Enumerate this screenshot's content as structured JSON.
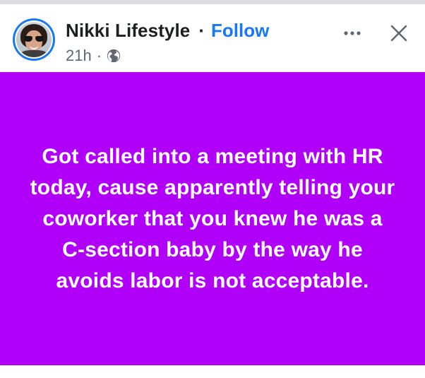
{
  "post": {
    "author_name": "Nikki Lifestyle",
    "separator": "·",
    "follow_label": "Follow",
    "timestamp": "21h",
    "meta_separator": "·",
    "audience_icon": "globe-icon",
    "more_icon": "more-horizontal-icon",
    "close_icon": "close-icon",
    "background_color": "#b000f9",
    "text": "Got called into a meeting with HR today, cause apparently telling your coworker that you knew he was a C-section baby by the way he avoids labor is not acceptable."
  }
}
